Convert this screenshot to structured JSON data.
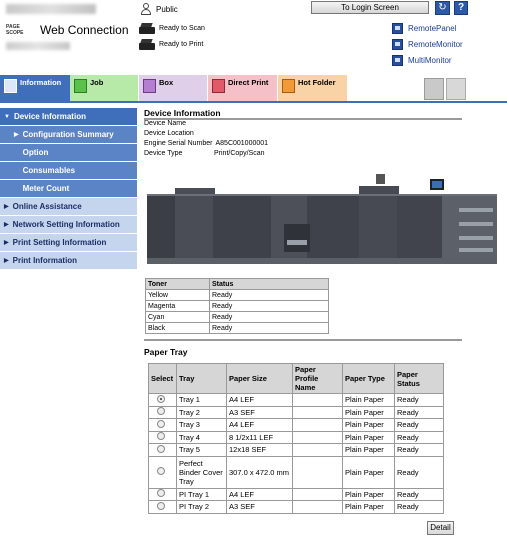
{
  "header": {
    "brand_top": "PAGE",
    "brand_bottom": "SCOPE",
    "app_title": "Web Connection",
    "user_label": "Public",
    "login_button": "To Login Screen",
    "refresh_icon": "refresh-icon",
    "help_label": "?",
    "scan_status": "Ready to Scan",
    "print_status": "Ready to Print",
    "links": [
      "RemotePanel",
      "RemoteMonitor",
      "MultiMonitor"
    ]
  },
  "tabs": [
    "Information",
    "Job",
    "Box",
    "Direct Print",
    "Hot Folder"
  ],
  "sidebar": {
    "items": [
      {
        "label": "Device Information",
        "level": "active"
      },
      {
        "label": "Configuration Summary",
        "level": "sub-current"
      },
      {
        "label": "Option",
        "level": "sub"
      },
      {
        "label": "Consumables",
        "level": "sub"
      },
      {
        "label": "Meter Count",
        "level": "sub"
      },
      {
        "label": "Online Assistance",
        "level": "top"
      },
      {
        "label": "Network Setting Information",
        "level": "top"
      },
      {
        "label": "Print Setting Information",
        "level": "top"
      },
      {
        "label": "Print Information",
        "level": "top"
      }
    ]
  },
  "device_info": {
    "title": "Device Information",
    "rows": [
      {
        "key": "Device Name",
        "value": ""
      },
      {
        "key": "Device Location",
        "value": ""
      },
      {
        "key": "Engine Serial Number",
        "value": "A85C001000001"
      },
      {
        "key": "Device Type",
        "value": "Print/Copy/Scan"
      }
    ]
  },
  "toner": {
    "headers": [
      "Toner",
      "Status"
    ],
    "rows": [
      [
        "Yellow",
        "Ready"
      ],
      [
        "Magenta",
        "Ready"
      ],
      [
        "Cyan",
        "Ready"
      ],
      [
        "Black",
        "Ready"
      ]
    ]
  },
  "paper_tray": {
    "title": "Paper Tray",
    "headers": [
      "Select",
      "Tray",
      "Paper Size",
      "Paper Profile Name",
      "Paper Type",
      "Paper Status"
    ],
    "rows": [
      {
        "selected": true,
        "tray": "Tray 1",
        "size": "A4 LEF",
        "profile": "",
        "type": "Plain Paper",
        "status": "Ready"
      },
      {
        "selected": false,
        "tray": "Tray 2",
        "size": "A3 SEF",
        "profile": "",
        "type": "Plain Paper",
        "status": "Ready"
      },
      {
        "selected": false,
        "tray": "Tray 3",
        "size": "A4 LEF",
        "profile": "",
        "type": "Plain Paper",
        "status": "Ready"
      },
      {
        "selected": false,
        "tray": "Tray 4",
        "size": "8 1/2x11 LEF",
        "profile": "",
        "type": "Plain Paper",
        "status": "Ready"
      },
      {
        "selected": false,
        "tray": "Tray 5",
        "size": "12x18 SEF",
        "profile": "",
        "type": "Plain Paper",
        "status": "Ready"
      },
      {
        "selected": false,
        "tray": "Perfect Binder Cover Tray",
        "size": "307.0 x 472.0 mm",
        "profile": "",
        "type": "Plain Paper",
        "status": "Ready"
      },
      {
        "selected": false,
        "tray": "PI Tray 1",
        "size": "A4 LEF",
        "profile": "",
        "type": "Plain Paper",
        "status": "Ready"
      },
      {
        "selected": false,
        "tray": "PI Tray 2",
        "size": "A3 SEF",
        "profile": "",
        "type": "Plain Paper",
        "status": "Ready"
      }
    ],
    "detail_button": "Detail"
  }
}
